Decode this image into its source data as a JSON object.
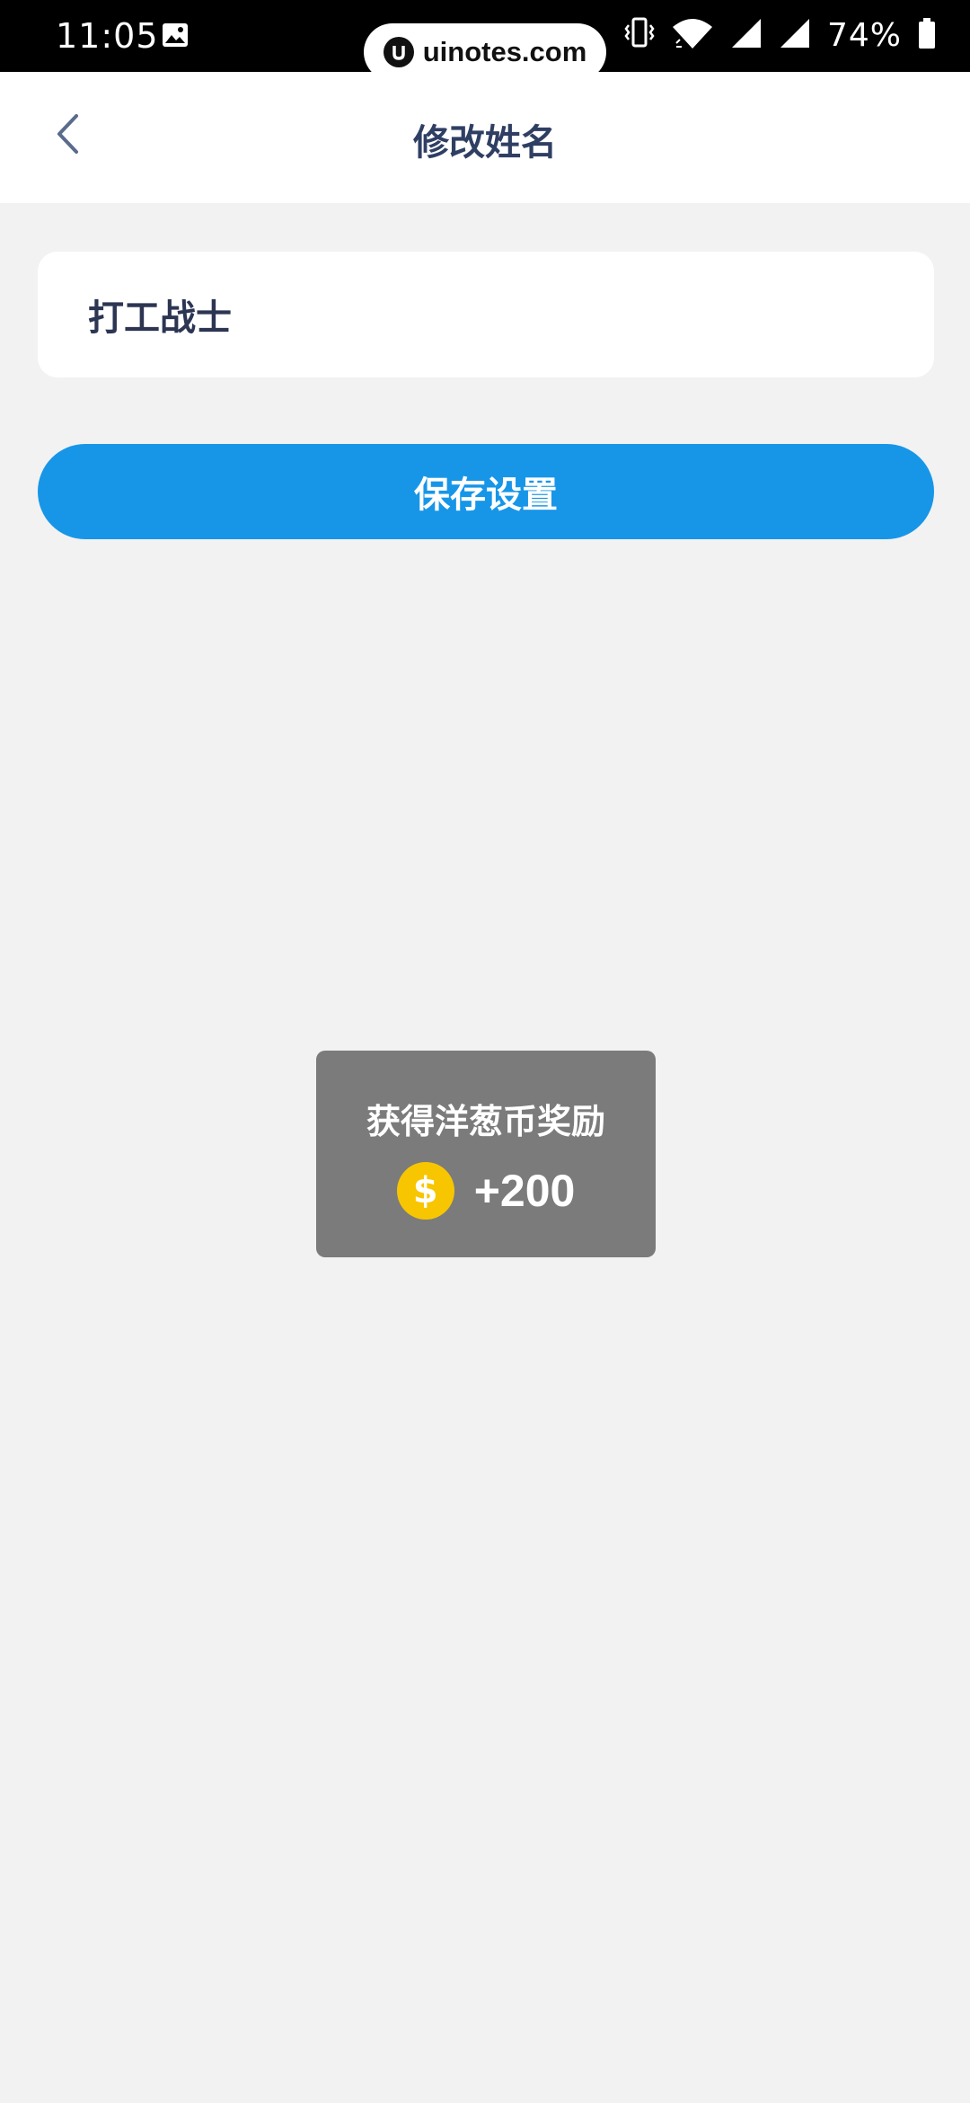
{
  "status_bar": {
    "time": "11:05",
    "battery": "74%",
    "icons": [
      "gallery-icon",
      "vibrate-icon",
      "wifi-icon",
      "signal-icon",
      "signal-icon",
      "battery-icon"
    ]
  },
  "watermark": {
    "text": "uinotes.com",
    "icon": "uinotes-logo-icon"
  },
  "header": {
    "title": "修改姓名",
    "back_icon": "chevron-left-icon"
  },
  "form": {
    "name_value": "打工战士"
  },
  "actions": {
    "save_label": "保存设置"
  },
  "toast": {
    "title": "获得洋葱币奖励",
    "coin_symbol": "$",
    "amount": "+200"
  },
  "colors": {
    "accent": "#1796e8",
    "title_text": "#2f3e63",
    "background": "#f2f2f2",
    "toast_bg": "#7b7b7b",
    "coin": "#f7c600"
  }
}
